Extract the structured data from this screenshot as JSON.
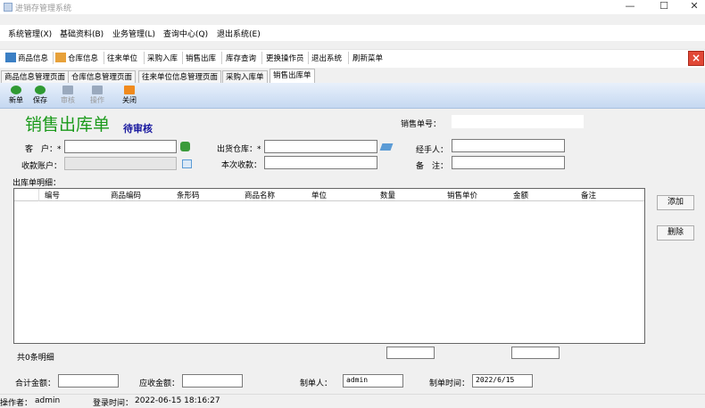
{
  "window": {
    "title": "进销存管理系统",
    "controls": [
      "—",
      "☐",
      "✕"
    ]
  },
  "menu": [
    "系统管理(X)",
    "基础资料(B)",
    "业务管理(L)",
    "查询中心(Q)",
    "退出系统(E)"
  ],
  "toolbar": [
    "商品信息",
    "仓库信息",
    "往来单位",
    "采购入库",
    "销售出库",
    "库存查询",
    "更换操作员",
    "退出系统",
    "刷新菜单"
  ],
  "close_button": "×",
  "tabs": [
    "商品信息管理页面",
    "仓库信息管理页面",
    "往来单位信息管理页面",
    "采购入库单",
    "销售出库单"
  ],
  "doc_toolbar": {
    "new": "新单",
    "save": "保存",
    "audit": "审核",
    "operate": "操作",
    "close": "关闭"
  },
  "form": {
    "title": "销售出库单",
    "status": "待审核",
    "order_no_label": "销售单号：",
    "order_no_value": "",
    "customer_label": "客　户：*",
    "customer_value": "",
    "account_label": "收款账户：",
    "account_value": "",
    "warehouse_label": "出货仓库：*",
    "warehouse_value": "",
    "receipt_label": "本次收款：",
    "receipt_value": "",
    "handler_label": "经手人：",
    "handler_value": "",
    "note_label": "备　注：",
    "note_value": "",
    "detail_label": "出库单明细："
  },
  "grid": {
    "columns": [
      "编号",
      "商品编码",
      "条形码",
      "商品名称",
      "单位",
      "数量",
      "销售单价",
      "金额",
      "备注"
    ],
    "rows": []
  },
  "side_buttons": {
    "add": "添加",
    "delete": "删除"
  },
  "summary": {
    "count": "共0条明细",
    "total_label": "合计金额：",
    "total_value": "",
    "receivable_label": "应收金额：",
    "receivable_value": "",
    "maker_label": "制单人：",
    "maker_value": "admin",
    "make_time_label": "制单时间：",
    "make_time_value": "2022/6/15"
  },
  "statusbar": {
    "operator_label": "操作者：",
    "operator_value": "admin",
    "login_label": "登录时间：",
    "login_value": "2022-06-15 18:16:27"
  }
}
